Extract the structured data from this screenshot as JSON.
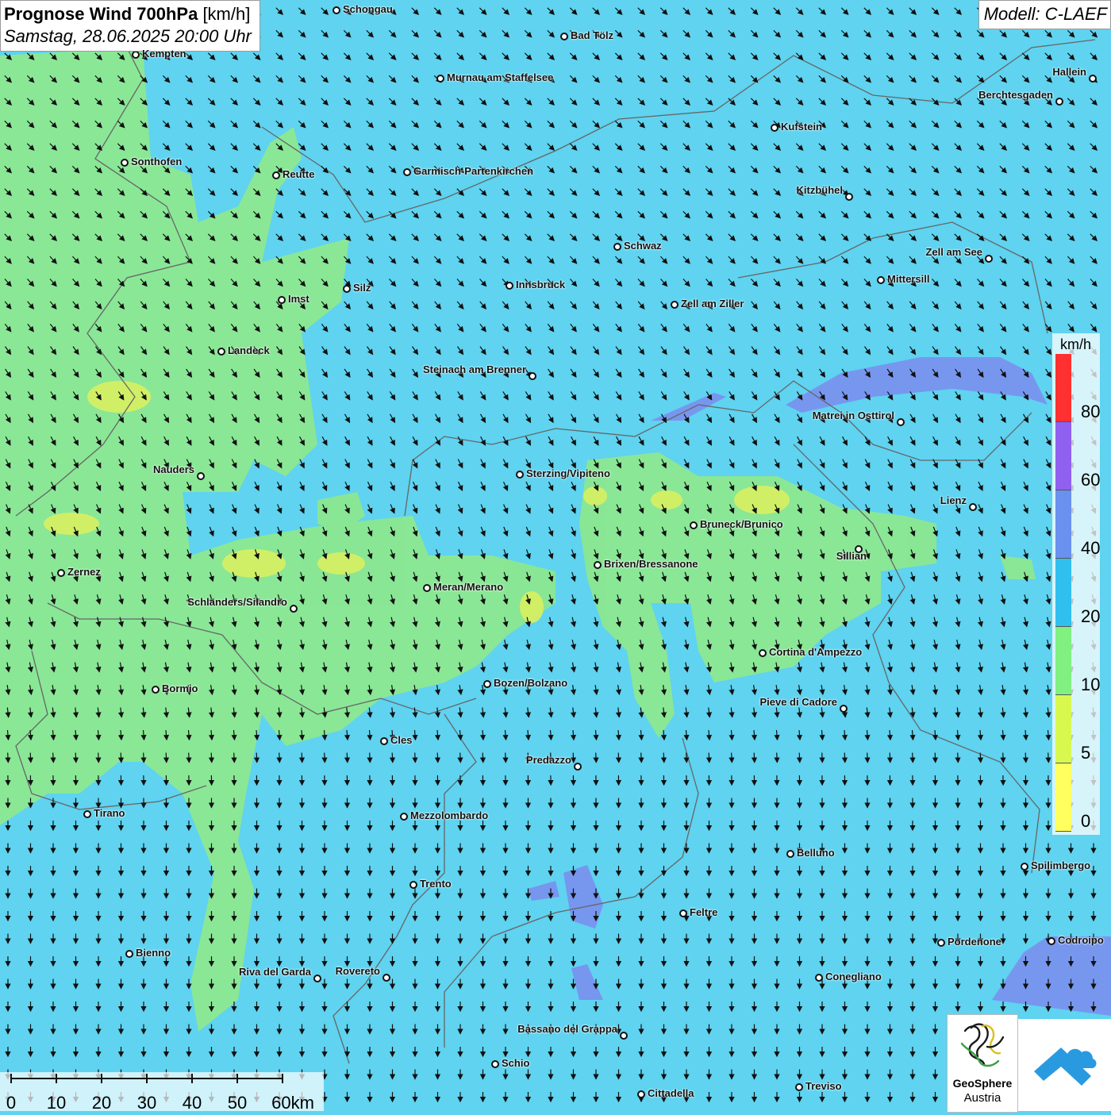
{
  "title": {
    "main": "Prognose Wind 700hPa",
    "unit": "[km/h]",
    "datetime": "Samstag, 28.06.2025 20:00 Uhr"
  },
  "model": "Modell: C-LAEF",
  "legend": {
    "unit": "km/h",
    "ticks": [
      "80",
      "60",
      "40",
      "20",
      "10",
      "5",
      "0"
    ],
    "colors": [
      "#ff3030",
      "#9060f0",
      "#6a90f0",
      "#30c0f0",
      "#80f080",
      "#d8f850",
      "#ffff60"
    ]
  },
  "scale": {
    "ticks": [
      "0",
      "10",
      "20",
      "30",
      "40",
      "50",
      "60km"
    ]
  },
  "logo": {
    "line1": "GeoSphere",
    "line2": "Austria",
    "icon": "geosphere-logo-icon",
    "app_icon": "cloud-app-icon"
  },
  "cities": [
    {
      "name": "Schongau"
    },
    {
      "name": "Bad Tölz"
    },
    {
      "name": "Kempten"
    },
    {
      "name": "Murnau am Staffelsee"
    },
    {
      "name": "Hallein"
    },
    {
      "name": "Berchtesgaden"
    },
    {
      "name": "Kufstein"
    },
    {
      "name": "Sonthofen"
    },
    {
      "name": "Reutte"
    },
    {
      "name": "Garmisch-Partenkirchen"
    },
    {
      "name": "Kitzbühel"
    },
    {
      "name": "Schwaz"
    },
    {
      "name": "Zell am See"
    },
    {
      "name": "Mittersill"
    },
    {
      "name": "Silz"
    },
    {
      "name": "Imst"
    },
    {
      "name": "Innsbruck"
    },
    {
      "name": "Zell am Ziller"
    },
    {
      "name": "Landeck"
    },
    {
      "name": "Steinach am Brenner"
    },
    {
      "name": "Matrei in Osttirol"
    },
    {
      "name": "Nauders"
    },
    {
      "name": "Sterzing/Vipiteno"
    },
    {
      "name": "Lienz"
    },
    {
      "name": "Bruneck/Brunico"
    },
    {
      "name": "Sillian"
    },
    {
      "name": "Brixen/Bressanone"
    },
    {
      "name": "Zernez"
    },
    {
      "name": "Meran/Merano"
    },
    {
      "name": "Schlanders/Silandro"
    },
    {
      "name": "Cortina d'Ampezzo"
    },
    {
      "name": "Bozen/Bolzano"
    },
    {
      "name": "Bormio"
    },
    {
      "name": "Pieve di Cadore"
    },
    {
      "name": "Cles"
    },
    {
      "name": "Predazzo"
    },
    {
      "name": "Tirano"
    },
    {
      "name": "Mezzolombardo"
    },
    {
      "name": "Belluno"
    },
    {
      "name": "Spilimbergo"
    },
    {
      "name": "Trento"
    },
    {
      "name": "Feltre"
    },
    {
      "name": "Pordenone"
    },
    {
      "name": "Codroipo"
    },
    {
      "name": "Bienno"
    },
    {
      "name": "Riva del Garda"
    },
    {
      "name": "Rovereto"
    },
    {
      "name": "Conegliano"
    },
    {
      "name": "Bassano del Grappa"
    },
    {
      "name": "Schio"
    },
    {
      "name": "Cittadella"
    },
    {
      "name": "Treviso"
    }
  ]
}
